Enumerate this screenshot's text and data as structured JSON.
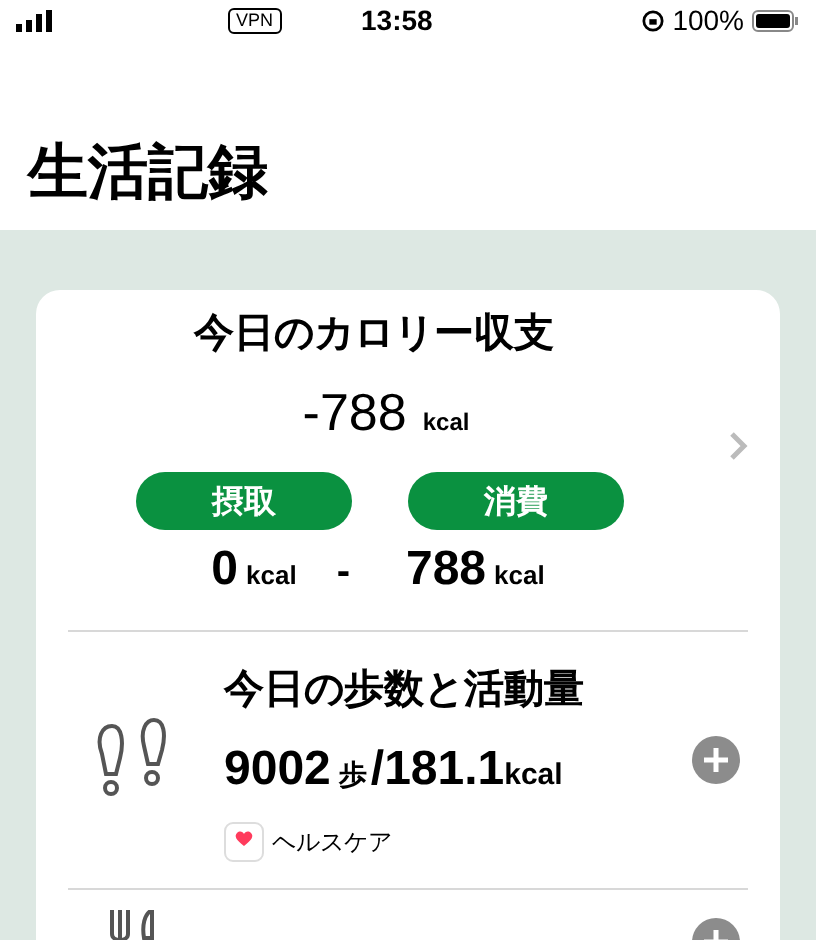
{
  "status_bar": {
    "vpn": "VPN",
    "time": "13:58",
    "battery": "100%"
  },
  "title": "生活記録",
  "calorie_card": {
    "title": "今日のカロリー収支",
    "balance": "-788",
    "balance_unit": "kcal",
    "intake_label": "摂取",
    "burn_label": "消費",
    "intake": "0",
    "intake_unit": "kcal",
    "operator": "-",
    "burn": "788",
    "burn_unit": "kcal"
  },
  "steps": {
    "title": "今日の歩数と活動量",
    "steps": "9002",
    "steps_unit": "歩",
    "separator": "/",
    "kcal": "181.1",
    "kcal_unit": "kcal",
    "source": "ヘルスケア"
  }
}
